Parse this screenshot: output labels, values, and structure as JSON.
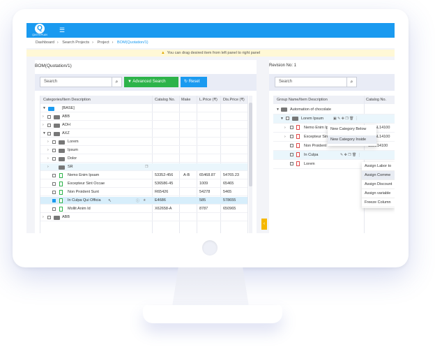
{
  "app": {
    "logo_letter": "Q",
    "logo_text": "QUOTEPLAN",
    "menu_icon": "hamburger-icon"
  },
  "breadcrumb": [
    "Dashboard",
    "Search Projects",
    "Project",
    "BOM(Quotation/1)"
  ],
  "notice": "You can drag desired item from left panel to right panel",
  "left": {
    "title": "BOM(Quotation/1)",
    "search_placeholder": "Search",
    "advanced_label": "Advanced Search",
    "reset_label": "Reset",
    "columns": [
      "Categories/Item Description",
      "Catalog No.",
      "Make",
      "L.Price (₹)",
      "Dis.Price (₹)"
    ],
    "rows": [
      {
        "label": "[BASE]",
        "catalog": "",
        "make": "",
        "lprice": "",
        "dprice": ""
      },
      {
        "label": "ABB",
        "catalog": "",
        "make": "",
        "lprice": "",
        "dprice": ""
      },
      {
        "label": "AOH",
        "catalog": "",
        "make": "",
        "lprice": "",
        "dprice": ""
      },
      {
        "label": "AXZ",
        "catalog": "",
        "make": "",
        "lprice": "",
        "dprice": ""
      },
      {
        "label": "Lorem",
        "catalog": "",
        "make": "",
        "lprice": "",
        "dprice": ""
      },
      {
        "label": "Ipsum",
        "catalog": "",
        "make": "",
        "lprice": "",
        "dprice": ""
      },
      {
        "label": "Dolor",
        "catalog": "",
        "make": "",
        "lprice": "",
        "dprice": ""
      },
      {
        "label": "SR",
        "catalog": "",
        "make": "",
        "lprice": "",
        "dprice": ""
      },
      {
        "label": "Nemo Enim Ipsam",
        "catalog": "53352-456",
        "make": "A-B",
        "lprice": "65468.87",
        "dprice": "54765.23"
      },
      {
        "label": "Excepteur Sint Occae",
        "catalog": "536586-45",
        "make": "",
        "lprice": "1009",
        "dprice": "65465"
      },
      {
        "label": "Non Proident Sunt",
        "catalog": "R65426",
        "make": "",
        "lprice": "54278",
        "dprice": "5465"
      },
      {
        "label": "In Culpa Qui Officia",
        "catalog": "E4686",
        "make": "",
        "lprice": "585",
        "dprice": "578655"
      },
      {
        "label": "Mollit Anim Id",
        "catalog": "X62658-A",
        "make": "",
        "lprice": "8787",
        "dprice": "650965"
      },
      {
        "label": "ABB",
        "catalog": "",
        "make": "",
        "lprice": "",
        "dprice": ""
      }
    ]
  },
  "right": {
    "title": "Revision No: 1",
    "search_placeholder": "Search",
    "columns": [
      "Group Name/Item Description",
      "Catalog No."
    ],
    "rows": [
      {
        "label": "Automation of chocolate",
        "catalog": ""
      },
      {
        "label": "Lorem Ipsum",
        "catalog": ""
      },
      {
        "label": "Nemo Enim Ip",
        "catalog": "5L14100"
      },
      {
        "label": "Excepteur Sin",
        "catalog": "5L14100"
      },
      {
        "label": "Non Proident",
        "catalog": "15BL14100"
      },
      {
        "label": "In Culpa",
        "catalog": ""
      },
      {
        "label": "Lorem",
        "catalog": ""
      }
    ],
    "menu_category": [
      "New Category Below",
      "New Category Inside"
    ],
    "menu_item": [
      "Assign Labor to",
      "Assign Comme",
      "Assign Discount",
      "Assign variable",
      "Freeze Column"
    ]
  }
}
